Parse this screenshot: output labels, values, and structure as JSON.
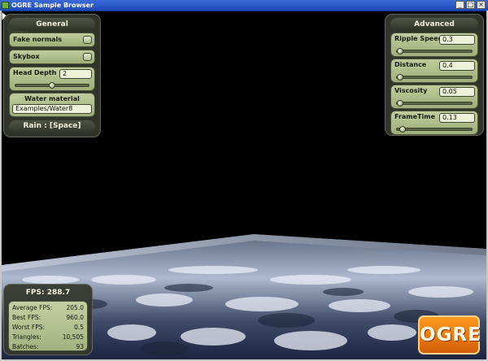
{
  "window": {
    "title": "OGRE Sample Browser",
    "minimize": "_",
    "maximize": "□",
    "close": "×"
  },
  "general": {
    "title": "General",
    "fake_normals_label": "Fake normals",
    "fake_normals_checked": false,
    "skybox_label": "Skybox",
    "skybox_checked": false,
    "head_depth_label": "Head Depth",
    "head_depth_value": "2",
    "head_depth_fraction": 0.5,
    "water_material_label": "Water material",
    "water_material_value": "Examples/Water8",
    "rain_label": "Rain : [Space]"
  },
  "advanced": {
    "title": "Advanced",
    "ripple_speed_label": "Ripple Speed",
    "ripple_speed_value": "0.3",
    "ripple_speed_fraction": 0.02,
    "distance_label": "Distance",
    "distance_value": "0.4",
    "distance_fraction": 0.02,
    "viscosity_label": "Viscosity",
    "viscosity_value": "0.05",
    "viscosity_fraction": 0.02,
    "frametime_label": "FrameTime",
    "frametime_value": "0.13",
    "frametime_fraction": 0.08
  },
  "stats": {
    "fps_title": "FPS: 288.7",
    "rows": [
      {
        "key": "Average FPS:",
        "value": "205.0"
      },
      {
        "key": "Best FPS:",
        "value": "960.0"
      },
      {
        "key": "Worst FPS:",
        "value": "0.5"
      },
      {
        "key": "Triangles:",
        "value": "10,505"
      },
      {
        "key": "Batches:",
        "value": "93"
      }
    ]
  },
  "logo": {
    "text": "OGRE"
  },
  "colors": {
    "tray_bg": "#34382c",
    "widget_green": "#b0bd8c",
    "title_bar_blue": "#1d49b8",
    "logo_orange": "#f07a10"
  },
  "icons": [
    "ogre-app-icon",
    "mouse-cursor-icon",
    "ogre-head-mesh"
  ]
}
